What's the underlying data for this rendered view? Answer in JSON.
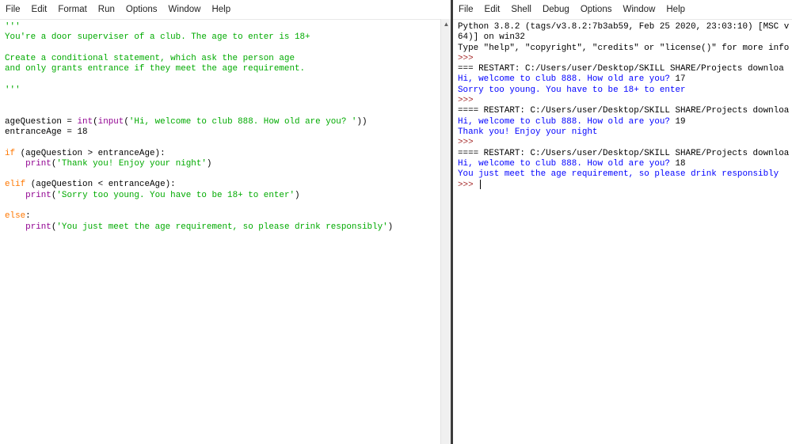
{
  "editor": {
    "menu": [
      "File",
      "Edit",
      "Format",
      "Run",
      "Options",
      "Window",
      "Help"
    ],
    "lines": [
      [
        {
          "t": "'''",
          "c": "str"
        }
      ],
      [
        {
          "t": "You're a door superviser of a club. The age to enter is 18+",
          "c": "str"
        }
      ],
      [],
      [
        {
          "t": "Create a conditional statement, which ask the person age",
          "c": "str"
        }
      ],
      [
        {
          "t": "and only grants entrance if they meet the age requirement.",
          "c": "str"
        }
      ],
      [],
      [
        {
          "t": "'''",
          "c": "str"
        }
      ],
      [],
      [],
      [
        {
          "t": "ageQuestion = ",
          "c": "txt"
        },
        {
          "t": "int",
          "c": "bi"
        },
        {
          "t": "(",
          "c": "txt"
        },
        {
          "t": "input",
          "c": "bi"
        },
        {
          "t": "(",
          "c": "txt"
        },
        {
          "t": "'Hi, welcome to club 888. How old are you? '",
          "c": "str"
        },
        {
          "t": "))",
          "c": "txt"
        }
      ],
      [
        {
          "t": "entranceAge = 18",
          "c": "txt"
        }
      ],
      [],
      [
        {
          "t": "if",
          "c": "kw"
        },
        {
          "t": " (ageQuestion > entranceAge):",
          "c": "txt"
        }
      ],
      [
        {
          "t": "    ",
          "c": "txt"
        },
        {
          "t": "print",
          "c": "bi"
        },
        {
          "t": "(",
          "c": "txt"
        },
        {
          "t": "'Thank you! Enjoy your night'",
          "c": "str"
        },
        {
          "t": ")",
          "c": "txt"
        }
      ],
      [],
      [
        {
          "t": "elif",
          "c": "kw"
        },
        {
          "t": " (ageQuestion < entranceAge):",
          "c": "txt"
        }
      ],
      [
        {
          "t": "    ",
          "c": "txt"
        },
        {
          "t": "print",
          "c": "bi"
        },
        {
          "t": "(",
          "c": "txt"
        },
        {
          "t": "'Sorry too young. You have to be 18+ to enter'",
          "c": "str"
        },
        {
          "t": ")",
          "c": "txt"
        }
      ],
      [],
      [
        {
          "t": "else",
          "c": "kw"
        },
        {
          "t": ":",
          "c": "txt"
        }
      ],
      [
        {
          "t": "    ",
          "c": "txt"
        },
        {
          "t": "print",
          "c": "bi"
        },
        {
          "t": "(",
          "c": "txt"
        },
        {
          "t": "'You just meet the age requirement, so please drink responsibly'",
          "c": "str"
        },
        {
          "t": ")",
          "c": "txt"
        }
      ]
    ]
  },
  "shell": {
    "menu": [
      "File",
      "Edit",
      "Shell",
      "Debug",
      "Options",
      "Window",
      "Help"
    ],
    "lines": [
      [
        {
          "t": "Python 3.8.2 (tags/v3.8.2:7b3ab59, Feb 25 2020, 23:03:10) [MSC v",
          "c": "txt"
        }
      ],
      [
        {
          "t": "64)] on win32",
          "c": "txt"
        }
      ],
      [
        {
          "t": "Type \"help\", \"copyright\", \"credits\" or \"license()\" for more info",
          "c": "txt"
        }
      ],
      [
        {
          "t": ">>>",
          "c": "prompt"
        }
      ],
      [
        {
          "t": "=== RESTART: C:/Users/user/Desktop/SKILL SHARE/Projects downloa",
          "c": "txt"
        }
      ],
      [
        {
          "t": "Hi, welcome to club 888. How old are you? ",
          "c": "out"
        },
        {
          "t": "17",
          "c": "txt"
        }
      ],
      [
        {
          "t": "Sorry too young. You have to be 18+ to enter",
          "c": "out"
        }
      ],
      [
        {
          "t": ">>>",
          "c": "prompt"
        }
      ],
      [
        {
          "t": "==== RESTART: C:/Users/user/Desktop/SKILL SHARE/Projects downloa",
          "c": "txt"
        }
      ],
      [
        {
          "t": "Hi, welcome to club 888. How old are you? ",
          "c": "out"
        },
        {
          "t": "19",
          "c": "txt"
        }
      ],
      [
        {
          "t": "Thank you! Enjoy your night",
          "c": "out"
        }
      ],
      [
        {
          "t": ">>>",
          "c": "prompt"
        }
      ],
      [
        {
          "t": "==== RESTART: C:/Users/user/Desktop/SKILL SHARE/Projects downloa",
          "c": "txt"
        }
      ],
      [
        {
          "t": "Hi, welcome to club 888. How old are you? ",
          "c": "out"
        },
        {
          "t": "18",
          "c": "txt"
        }
      ],
      [
        {
          "t": "You just meet the age requirement, so please drink responsibly",
          "c": "out"
        }
      ],
      [
        {
          "t": ">>> ",
          "c": "prompt"
        }
      ]
    ]
  }
}
